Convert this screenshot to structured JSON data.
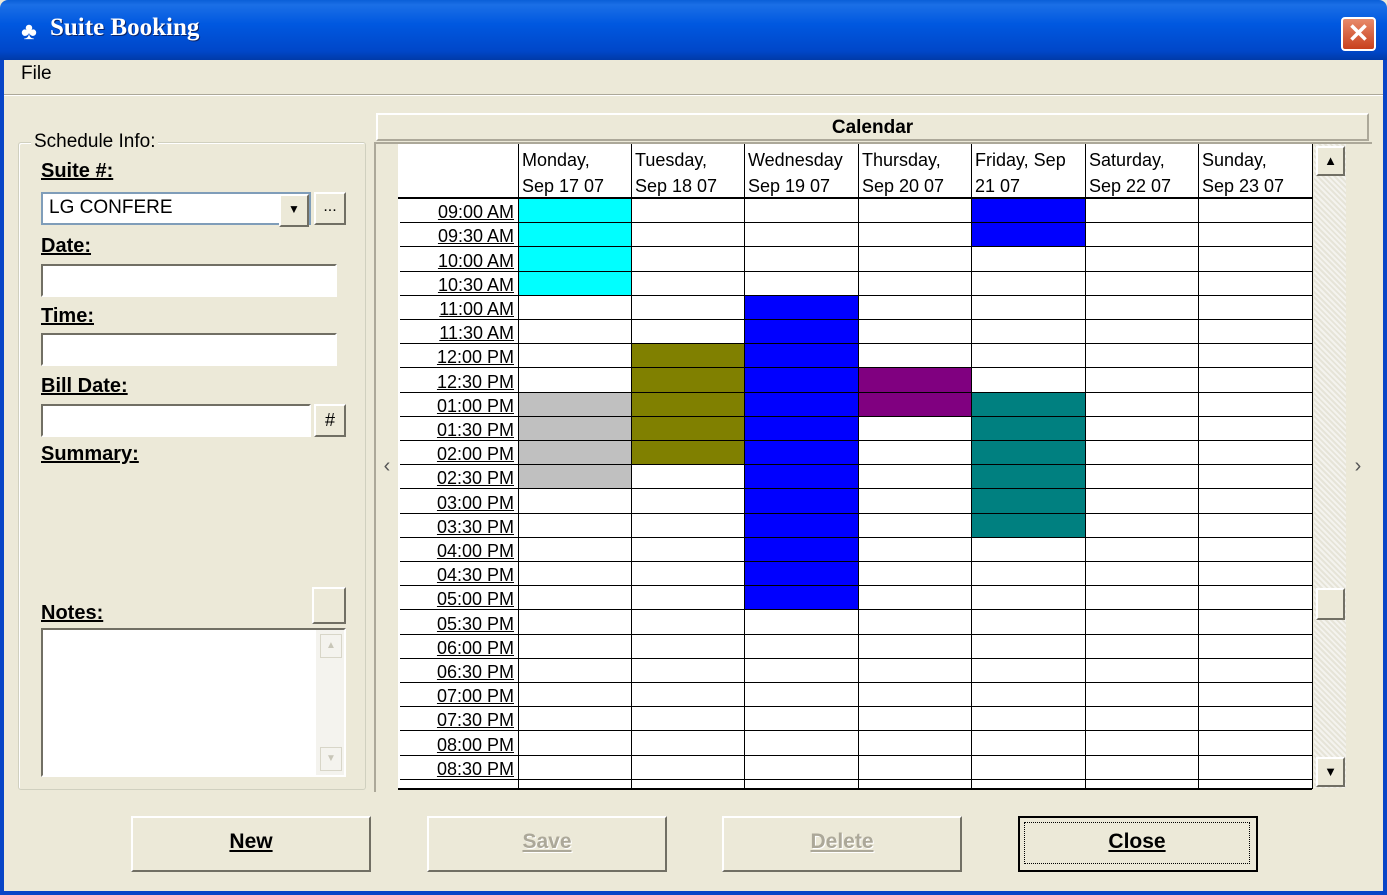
{
  "window": {
    "title": "Suite Booking",
    "icon": "app-icon",
    "close_glyph": "✕"
  },
  "menu": {
    "file": "File"
  },
  "schedule": {
    "group_title": "Schedule Info:",
    "suite_label": "Suite #:",
    "suite_value": "LG CONFERE",
    "browse_label": "...",
    "date_label": "Date:",
    "date_value": "",
    "time_label": "Time:",
    "time_value": "",
    "bill_date_label": "Bill Date:",
    "bill_date_value": "",
    "bill_date_button": "#",
    "summary_label": "Summary:",
    "notes_label": "Notes:",
    "notes_value": ""
  },
  "calendar": {
    "title": "Calendar",
    "days": [
      "Monday,\nSep 17 07",
      "Tuesday,\nSep 18 07",
      "Wednesday\nSep 19 07",
      "Thursday,\nSep 20 07",
      "Friday, Sep\n21 07",
      "Saturday,\nSep 22 07",
      "Sunday,\nSep 23 07"
    ],
    "times": [
      "09:00 AM",
      "09:30 AM",
      "10:00 AM",
      "10:30 AM",
      "11:00 AM",
      "11:30 AM",
      "12:00 PM",
      "12:30 PM",
      "01:00 PM",
      "01:30 PM",
      "02:00 PM",
      "02:30 PM",
      "03:00 PM",
      "03:30 PM",
      "04:00 PM",
      "04:30 PM",
      "05:00 PM",
      "05:30 PM",
      "06:00 PM",
      "06:30 PM",
      "07:00 PM",
      "07:30 PM",
      "08:00 PM",
      "08:30 PM"
    ],
    "bookings": [
      {
        "day": 0,
        "start": "09:00 AM",
        "end": "11:00 AM",
        "color": "#00ffff"
      },
      {
        "day": 0,
        "start": "01:00 PM",
        "end": "03:00 PM",
        "color": "#c0c0c0"
      },
      {
        "day": 1,
        "start": "12:00 PM",
        "end": "02:30 PM",
        "color": "#808000"
      },
      {
        "day": 2,
        "start": "11:00 AM",
        "end": "05:30 PM",
        "color": "#0000ff"
      },
      {
        "day": 3,
        "start": "12:30 PM",
        "end": "01:30 PM",
        "color": "#800080"
      },
      {
        "day": 4,
        "start": "09:00 AM",
        "end": "10:00 AM",
        "color": "#0000ff"
      },
      {
        "day": 4,
        "start": "01:00 PM",
        "end": "04:00 PM",
        "color": "#008080"
      }
    ],
    "scroll_left": "‹",
    "scroll_right": "›"
  },
  "buttons": {
    "new": "New",
    "save": "Save",
    "delete": "Delete",
    "close": "Close"
  }
}
